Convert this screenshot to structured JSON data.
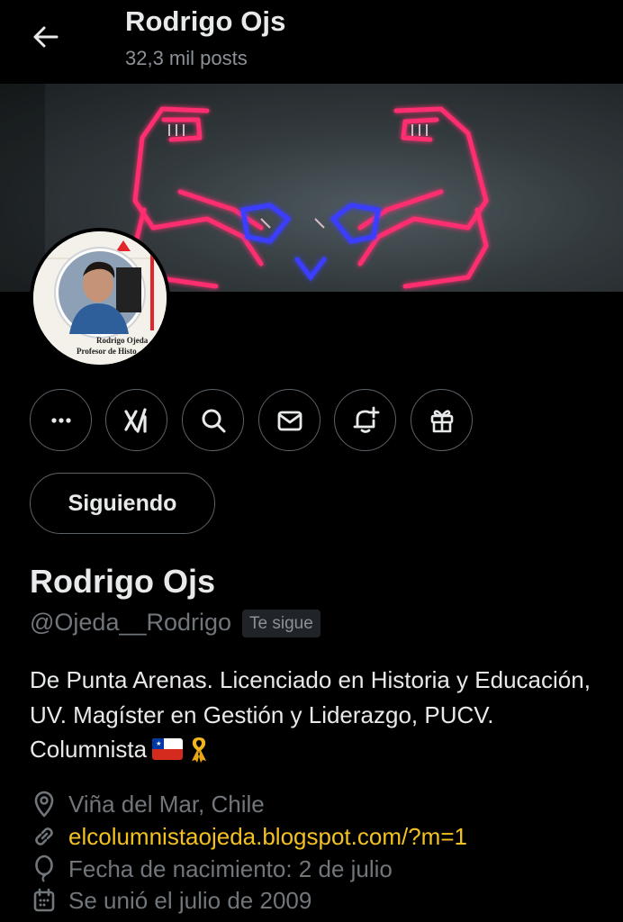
{
  "header": {
    "title": "Rodrigo Ojs",
    "subtitle": "32,3 mil posts"
  },
  "avatar_card": {
    "name": "Rodrigo Ojeda",
    "role": "Profesor de Histo"
  },
  "actions": {
    "follow_label": "Siguiendo",
    "icons": [
      "more-icon",
      "grok-icon",
      "search-icon",
      "message-icon",
      "notification-add-icon",
      "gift-icon"
    ]
  },
  "profile": {
    "name": "Rodrigo Ojs",
    "handle": "@Ojeda__Rodrigo",
    "follows_you": "Te sigue",
    "bio": "De Punta Arenas. Licenciado en Historia y Educación, UV. Magíster en Gestión y Liderazgo, PUCV. Columnista",
    "location": "Viña del Mar, Chile",
    "website": "elcolumnistaojeda.blogspot.com/?m=1",
    "birthday": "Fecha de nacimiento: 2 de julio",
    "joined": "Se unió el julio de 2009"
  },
  "colors": {
    "background": "#000000",
    "text": "#e7e9ea",
    "muted": "#71767b",
    "link": "#f3c121",
    "border": "#5b6268"
  }
}
